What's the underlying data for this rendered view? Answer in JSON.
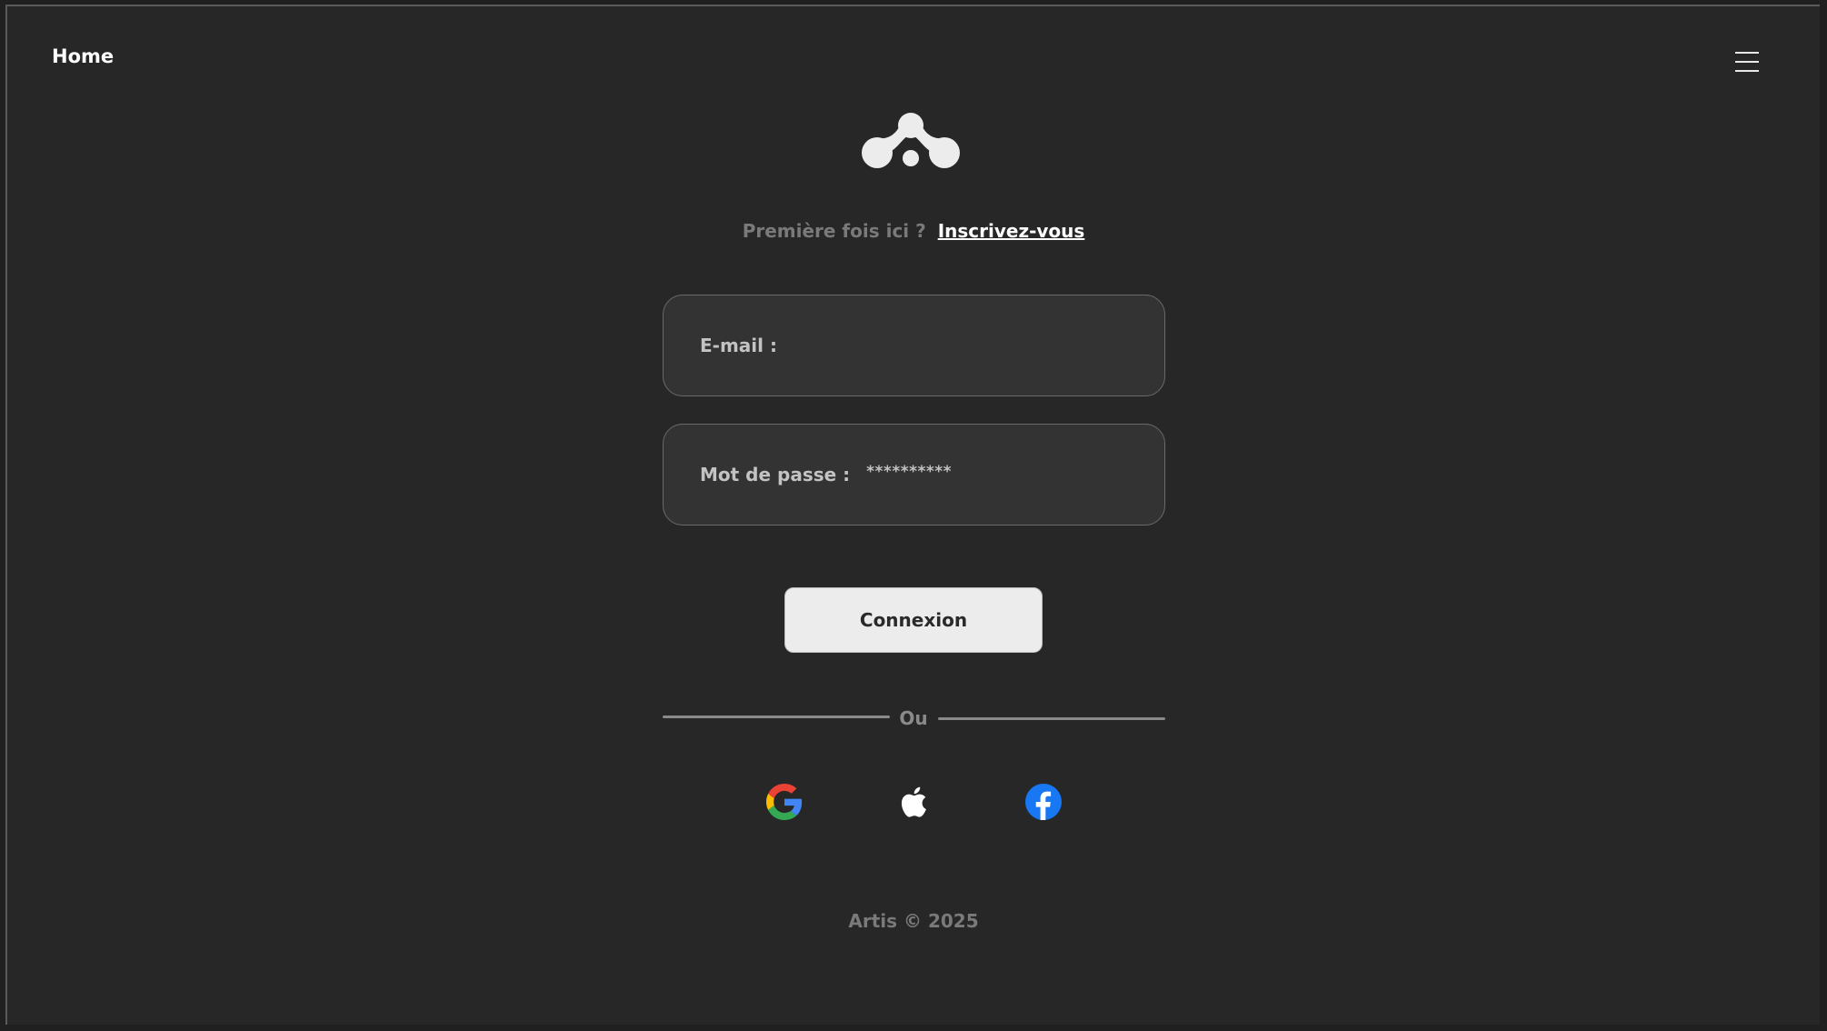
{
  "nav": {
    "home_label": "Home",
    "menu_icon": "hamburger-menu-icon"
  },
  "brand": {
    "logo_icon": "artis-logo-icon",
    "logo_color": "#ececec"
  },
  "signup": {
    "prompt": "Première fois ici ?",
    "link_label": "Inscrivez-vous"
  },
  "form": {
    "email": {
      "label": "E-mail :",
      "value": ""
    },
    "password": {
      "label": "Mot de passe :",
      "value": "**********"
    },
    "submit_label": "Connexion"
  },
  "divider": {
    "label": "Ou"
  },
  "social": {
    "google_icon": "google-icon",
    "apple_icon": "apple-icon",
    "facebook_icon": "facebook-icon",
    "facebook_color": "#1877F2"
  },
  "footer": {
    "text": "Artis © 2025"
  },
  "colors": {
    "background": "#272727",
    "field_background": "#333333",
    "button_background": "#ececec",
    "muted_text": "#7a7a7a"
  }
}
